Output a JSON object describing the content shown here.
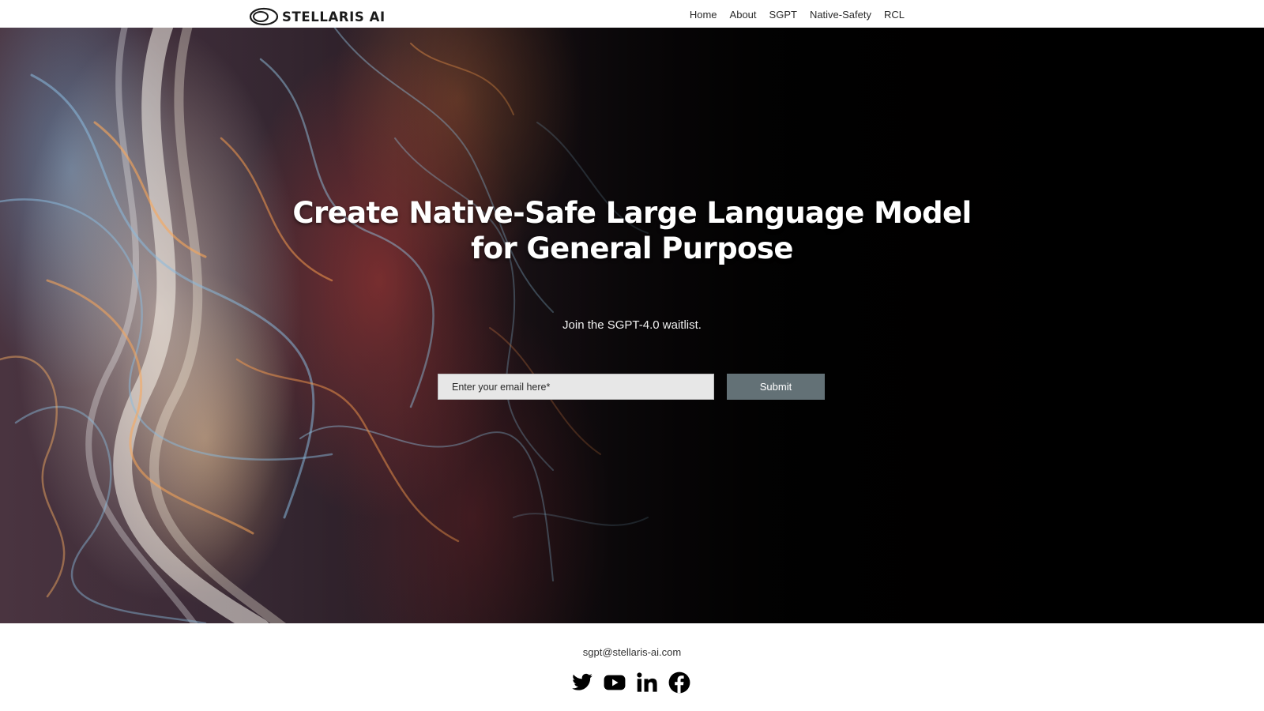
{
  "header": {
    "logo_text": "STELLARIS AI",
    "nav": [
      "Home",
      "About",
      "SGPT",
      "Native-Safety",
      "RCL"
    ]
  },
  "hero": {
    "headline_line1": "Create Native-Safe Large Language Model",
    "headline_line2": "for General Purpose",
    "subline": "Join the SGPT-4.0 waitlist.",
    "email_placeholder": "Enter your email here*",
    "email_value": "",
    "submit_label": "Submit"
  },
  "footer": {
    "email": "sgpt@stellaris-ai.com",
    "social_icons": [
      "twitter-icon",
      "youtube-icon",
      "linkedin-icon",
      "facebook-icon"
    ]
  },
  "colors": {
    "submit_bg": "#637176",
    "email_field_bg": "#e7e7e7",
    "hero_text": "#ffffff"
  }
}
